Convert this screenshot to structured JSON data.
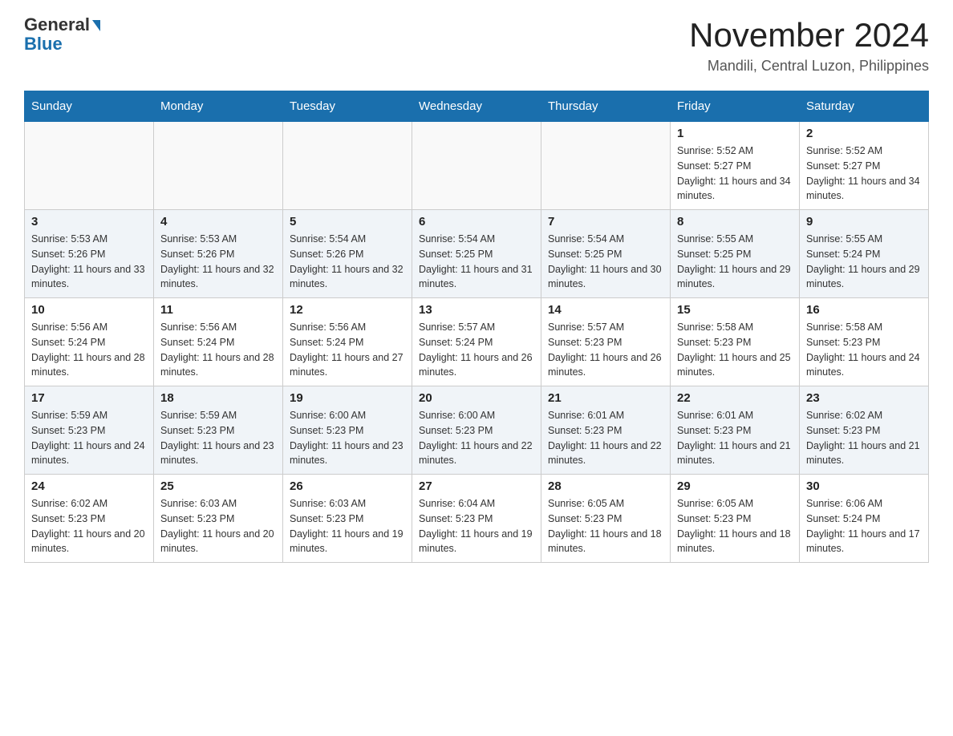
{
  "header": {
    "logo_general": "General",
    "logo_blue": "Blue",
    "month_year": "November 2024",
    "location": "Mandili, Central Luzon, Philippines"
  },
  "days_of_week": [
    "Sunday",
    "Monday",
    "Tuesday",
    "Wednesday",
    "Thursday",
    "Friday",
    "Saturday"
  ],
  "weeks": [
    {
      "days": [
        {
          "number": "",
          "info": ""
        },
        {
          "number": "",
          "info": ""
        },
        {
          "number": "",
          "info": ""
        },
        {
          "number": "",
          "info": ""
        },
        {
          "number": "",
          "info": ""
        },
        {
          "number": "1",
          "info": "Sunrise: 5:52 AM\nSunset: 5:27 PM\nDaylight: 11 hours and 34 minutes."
        },
        {
          "number": "2",
          "info": "Sunrise: 5:52 AM\nSunset: 5:27 PM\nDaylight: 11 hours and 34 minutes."
        }
      ]
    },
    {
      "days": [
        {
          "number": "3",
          "info": "Sunrise: 5:53 AM\nSunset: 5:26 PM\nDaylight: 11 hours and 33 minutes."
        },
        {
          "number": "4",
          "info": "Sunrise: 5:53 AM\nSunset: 5:26 PM\nDaylight: 11 hours and 32 minutes."
        },
        {
          "number": "5",
          "info": "Sunrise: 5:54 AM\nSunset: 5:26 PM\nDaylight: 11 hours and 32 minutes."
        },
        {
          "number": "6",
          "info": "Sunrise: 5:54 AM\nSunset: 5:25 PM\nDaylight: 11 hours and 31 minutes."
        },
        {
          "number": "7",
          "info": "Sunrise: 5:54 AM\nSunset: 5:25 PM\nDaylight: 11 hours and 30 minutes."
        },
        {
          "number": "8",
          "info": "Sunrise: 5:55 AM\nSunset: 5:25 PM\nDaylight: 11 hours and 29 minutes."
        },
        {
          "number": "9",
          "info": "Sunrise: 5:55 AM\nSunset: 5:24 PM\nDaylight: 11 hours and 29 minutes."
        }
      ]
    },
    {
      "days": [
        {
          "number": "10",
          "info": "Sunrise: 5:56 AM\nSunset: 5:24 PM\nDaylight: 11 hours and 28 minutes."
        },
        {
          "number": "11",
          "info": "Sunrise: 5:56 AM\nSunset: 5:24 PM\nDaylight: 11 hours and 28 minutes."
        },
        {
          "number": "12",
          "info": "Sunrise: 5:56 AM\nSunset: 5:24 PM\nDaylight: 11 hours and 27 minutes."
        },
        {
          "number": "13",
          "info": "Sunrise: 5:57 AM\nSunset: 5:24 PM\nDaylight: 11 hours and 26 minutes."
        },
        {
          "number": "14",
          "info": "Sunrise: 5:57 AM\nSunset: 5:23 PM\nDaylight: 11 hours and 26 minutes."
        },
        {
          "number": "15",
          "info": "Sunrise: 5:58 AM\nSunset: 5:23 PM\nDaylight: 11 hours and 25 minutes."
        },
        {
          "number": "16",
          "info": "Sunrise: 5:58 AM\nSunset: 5:23 PM\nDaylight: 11 hours and 24 minutes."
        }
      ]
    },
    {
      "days": [
        {
          "number": "17",
          "info": "Sunrise: 5:59 AM\nSunset: 5:23 PM\nDaylight: 11 hours and 24 minutes."
        },
        {
          "number": "18",
          "info": "Sunrise: 5:59 AM\nSunset: 5:23 PM\nDaylight: 11 hours and 23 minutes."
        },
        {
          "number": "19",
          "info": "Sunrise: 6:00 AM\nSunset: 5:23 PM\nDaylight: 11 hours and 23 minutes."
        },
        {
          "number": "20",
          "info": "Sunrise: 6:00 AM\nSunset: 5:23 PM\nDaylight: 11 hours and 22 minutes."
        },
        {
          "number": "21",
          "info": "Sunrise: 6:01 AM\nSunset: 5:23 PM\nDaylight: 11 hours and 22 minutes."
        },
        {
          "number": "22",
          "info": "Sunrise: 6:01 AM\nSunset: 5:23 PM\nDaylight: 11 hours and 21 minutes."
        },
        {
          "number": "23",
          "info": "Sunrise: 6:02 AM\nSunset: 5:23 PM\nDaylight: 11 hours and 21 minutes."
        }
      ]
    },
    {
      "days": [
        {
          "number": "24",
          "info": "Sunrise: 6:02 AM\nSunset: 5:23 PM\nDaylight: 11 hours and 20 minutes."
        },
        {
          "number": "25",
          "info": "Sunrise: 6:03 AM\nSunset: 5:23 PM\nDaylight: 11 hours and 20 minutes."
        },
        {
          "number": "26",
          "info": "Sunrise: 6:03 AM\nSunset: 5:23 PM\nDaylight: 11 hours and 19 minutes."
        },
        {
          "number": "27",
          "info": "Sunrise: 6:04 AM\nSunset: 5:23 PM\nDaylight: 11 hours and 19 minutes."
        },
        {
          "number": "28",
          "info": "Sunrise: 6:05 AM\nSunset: 5:23 PM\nDaylight: 11 hours and 18 minutes."
        },
        {
          "number": "29",
          "info": "Sunrise: 6:05 AM\nSunset: 5:23 PM\nDaylight: 11 hours and 18 minutes."
        },
        {
          "number": "30",
          "info": "Sunrise: 6:06 AM\nSunset: 5:24 PM\nDaylight: 11 hours and 17 minutes."
        }
      ]
    }
  ]
}
